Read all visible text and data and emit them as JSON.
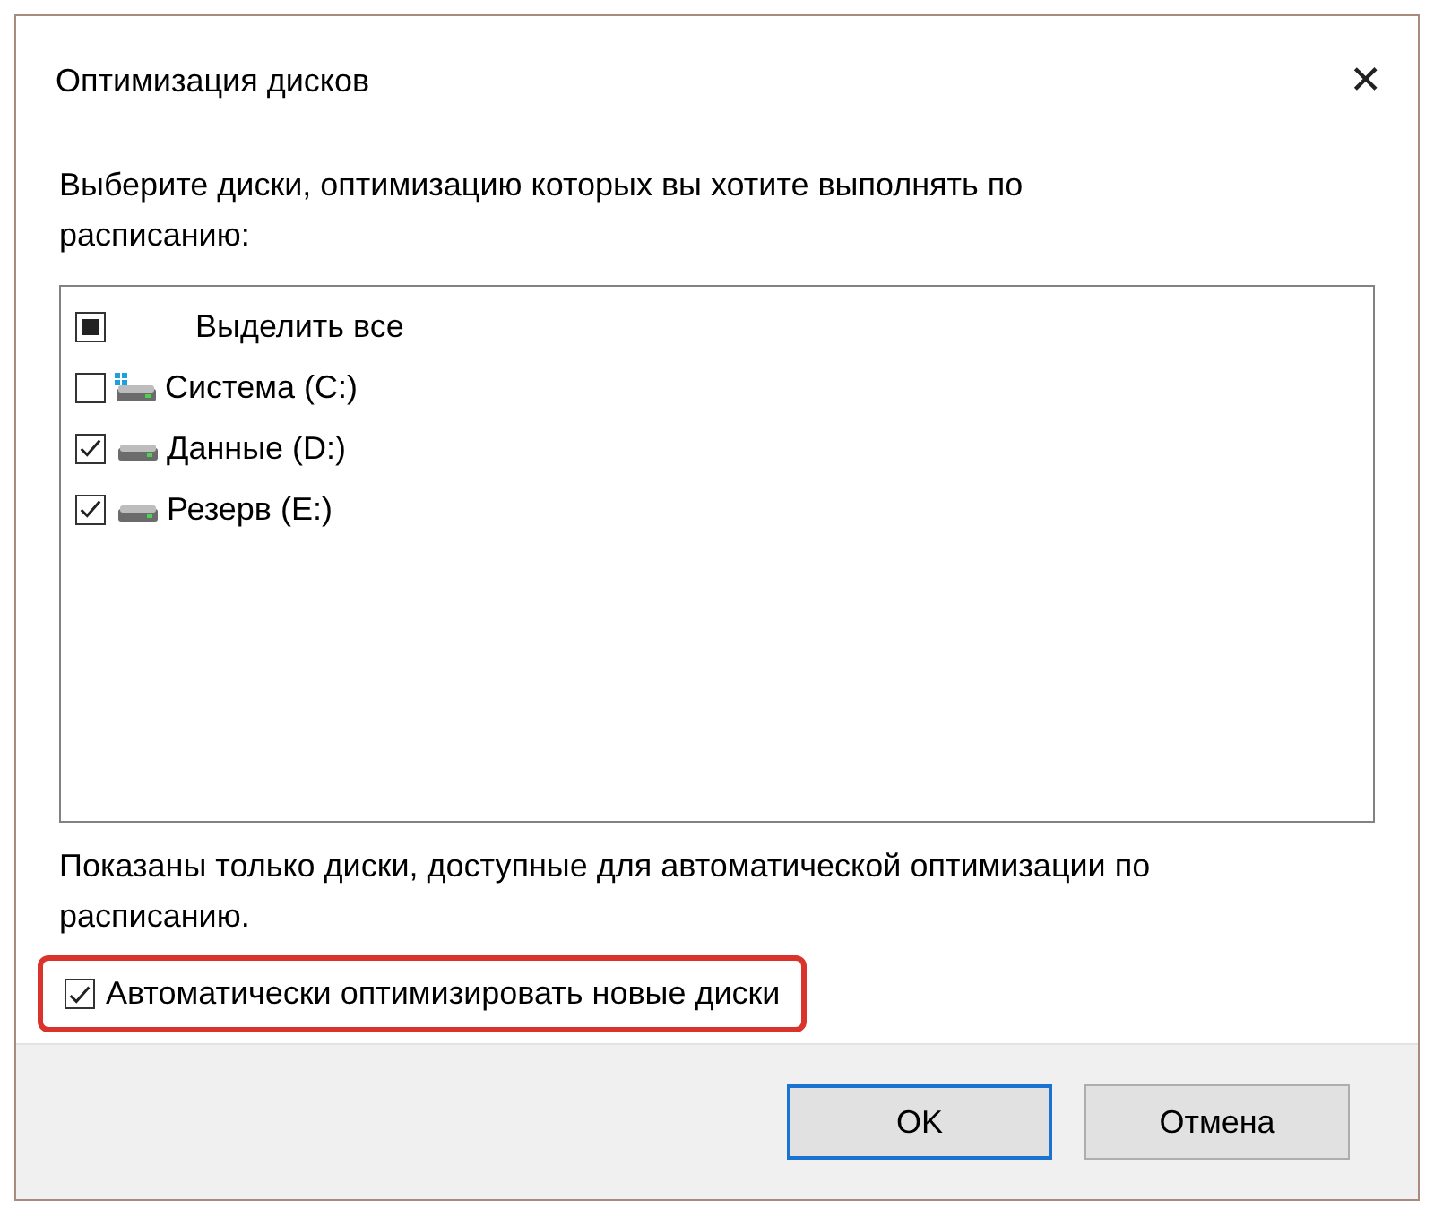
{
  "window": {
    "title": "Оптимизация дисков",
    "close": "✕"
  },
  "intro": "Выберите диски, оптимизацию которых вы хотите выполнять по расписанию:",
  "drives": [
    {
      "kind": "all",
      "label": "Выделить все",
      "checked": false,
      "indeterminate": true
    },
    {
      "kind": "system",
      "label": "Система (C:)",
      "checked": false
    },
    {
      "kind": "drive",
      "label": "Данные (D:)",
      "checked": true
    },
    {
      "kind": "drive",
      "label": "Резерв (E:)",
      "checked": true
    }
  ],
  "note": "Показаны только диски, доступные для автоматической оптимизации по расписанию.",
  "auto_option": {
    "label": "Автоматически оптимизировать новые диски",
    "checked": true,
    "highlighted": true
  },
  "buttons": [
    {
      "label": "OK",
      "default": true
    },
    {
      "label": "Отмена",
      "default": false
    }
  ]
}
